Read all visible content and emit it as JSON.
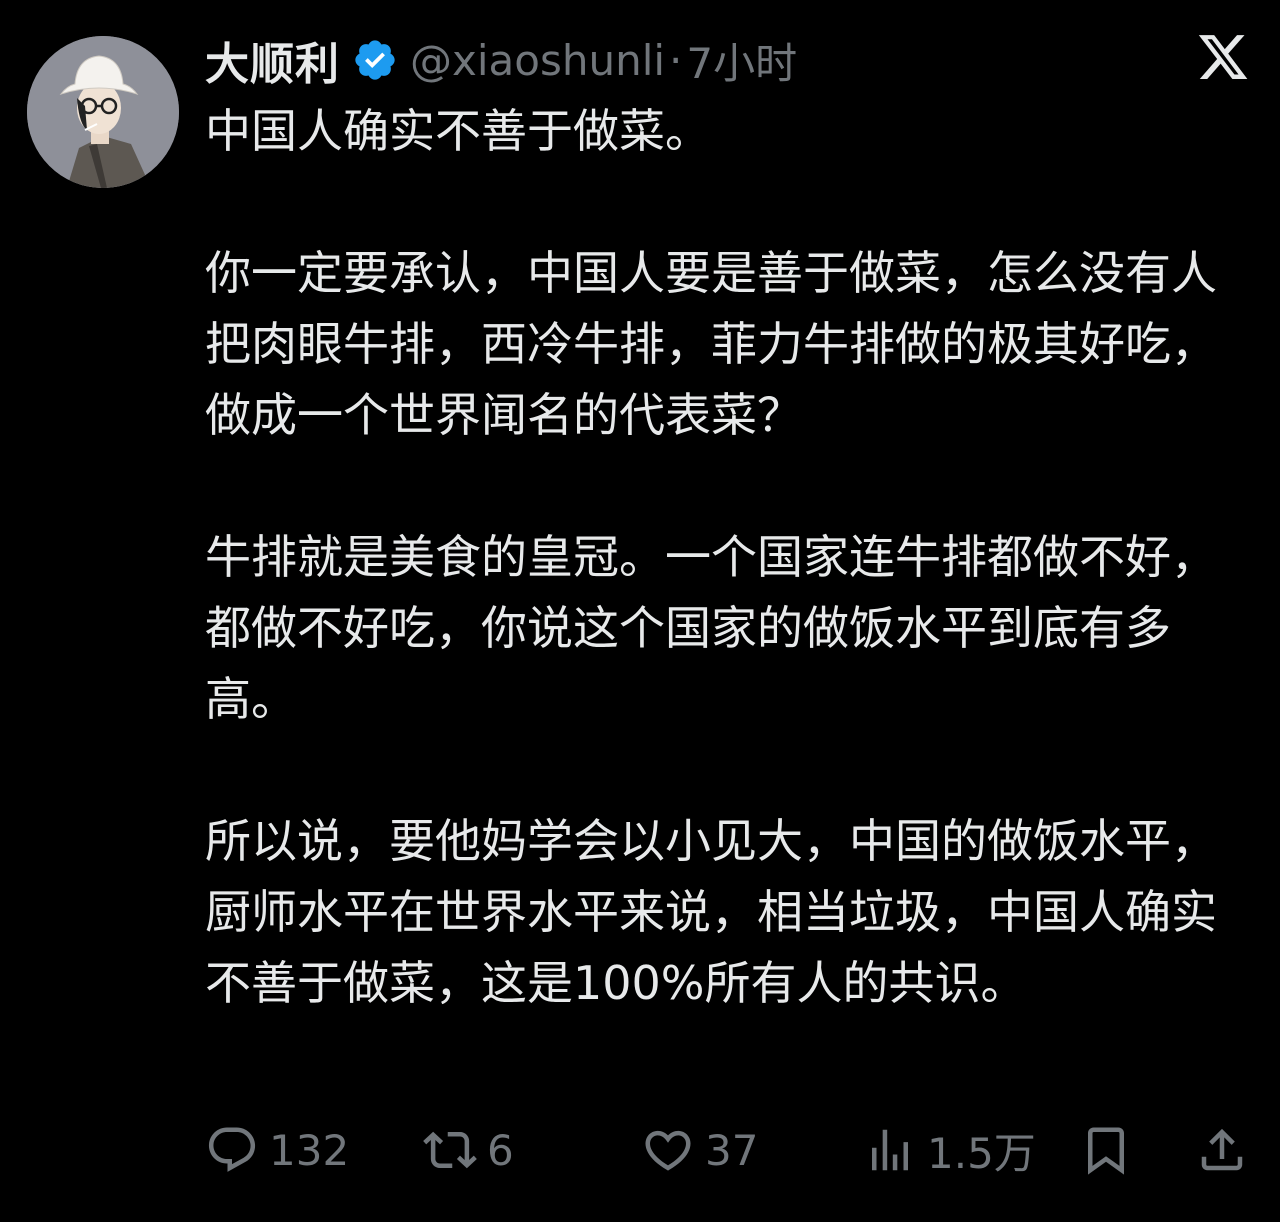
{
  "author": {
    "display_name": "大顺利",
    "handle": "@xiaoshunli",
    "separator": "·",
    "time": "7小时",
    "verified_icon": "verified-badge-icon",
    "verified_color": "#1d9bf0"
  },
  "platform_icon": "x-logo-icon",
  "tweet": {
    "paragraphs": [
      "中国人确实不善于做菜。",
      "你一定要承认，中国人要是善于做菜，怎么没有人把肉眼牛排，西冷牛排，菲力牛排做的极其好吃，做成一个世界闻名的代表菜？",
      "牛排就是美食的皇冠。一个国家连牛排都做不好，都做不好吃，你说这个国家的做饭水平到底有多高。",
      "所以说，要他妈学会以小见大，中国的做饭水平，厨师水平在世界水平来说，相当垃圾，中国人确实不善于做菜，这是100%所有人的共识。"
    ]
  },
  "actions": {
    "reply": {
      "icon": "reply-icon",
      "count": "132"
    },
    "retweet": {
      "icon": "retweet-icon",
      "count": "6"
    },
    "like": {
      "icon": "heart-icon",
      "count": "37"
    },
    "views": {
      "icon": "views-icon",
      "count": "1.5万"
    },
    "bookmark": {
      "icon": "bookmark-icon"
    },
    "share": {
      "icon": "share-icon"
    }
  },
  "colors": {
    "background": "#000000",
    "text": "#e7e9ea",
    "secondary": "#71767b"
  }
}
